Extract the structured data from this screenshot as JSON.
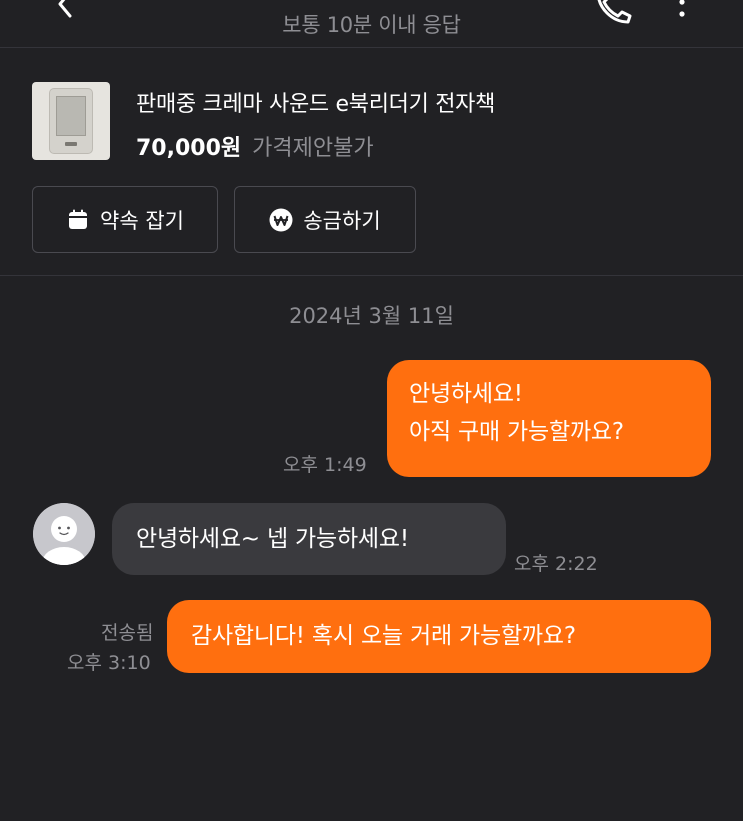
{
  "header": {
    "subtitle": "보통 10분 이내 응답",
    "icons": [
      "chevron-left-icon",
      "phone-icon",
      "more-vertical-icon"
    ]
  },
  "product": {
    "status": "판매중",
    "name": "크레마 사운드 e북리더기 전자책",
    "title": "판매중 크레마 사운드 e북리더기 전자책",
    "price": "70,000원",
    "negotiation": "가격제안불가"
  },
  "actions": {
    "appointment_label": "약속 잡기",
    "transfer_label": "송금하기"
  },
  "chat": {
    "date": "2024년 3월 11일",
    "messages": [
      {
        "from": "me",
        "lines": [
          "안녕하세요!",
          "아직 구매 가능할까요?"
        ],
        "time": "오후 1:49"
      },
      {
        "from": "other",
        "text": "안녕하세요~ 넵 가능하세요!",
        "time": "오후 2:22"
      },
      {
        "from": "me",
        "text": "감사합니다! 혹시 오늘 거래 가능할까요?",
        "status": "전송됨",
        "time": "오후 3:10"
      }
    ]
  },
  "colors": {
    "background": "#212124",
    "accent": "#ff6f0f",
    "bubble_other": "#3a3a3e",
    "muted_text": "#8e8e93"
  }
}
